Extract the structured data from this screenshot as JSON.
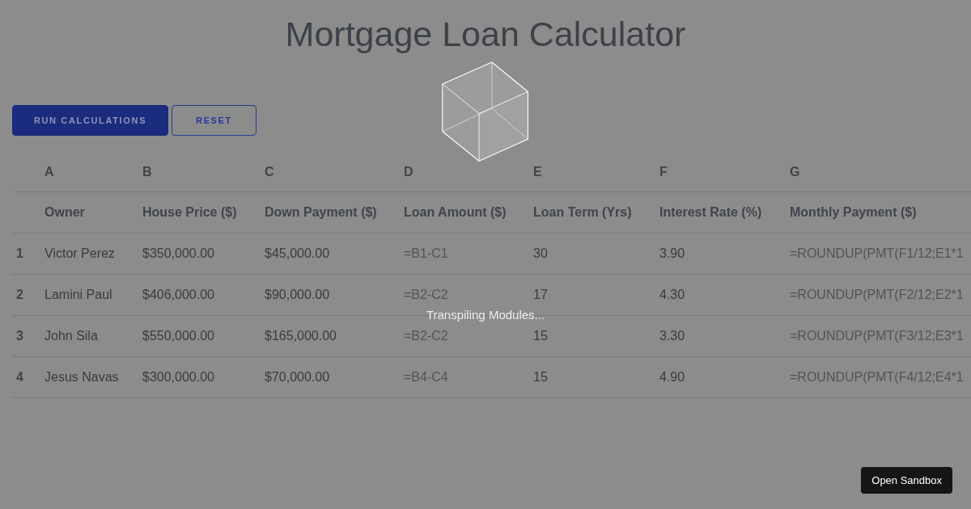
{
  "title": "Mortgage Loan Calculator",
  "buttons": [
    {
      "kind": "primary",
      "label": "RUN CALCULATIONS"
    },
    {
      "kind": "outline",
      "label": "RESET"
    }
  ],
  "table": {
    "columns": [
      {
        "letter": "A",
        "header": "Owner"
      },
      {
        "letter": "B",
        "header": "House Price ($)"
      },
      {
        "letter": "C",
        "header": "Down Payment ($)"
      },
      {
        "letter": "D",
        "header": "Loan Amount ($)"
      },
      {
        "letter": "E",
        "header": "Loan Term (Yrs)"
      },
      {
        "letter": "F",
        "header": "Interest Rate (%)"
      },
      {
        "letter": "G",
        "header": "Monthly Payment ($)"
      }
    ],
    "rows": [
      {
        "number": "1",
        "cells": [
          {
            "kind": "value",
            "text": "Victor Perez"
          },
          {
            "kind": "value",
            "text": "$350,000.00"
          },
          {
            "kind": "value",
            "text": "$45,000.00"
          },
          {
            "kind": "formula",
            "text": "=B1-C1"
          },
          {
            "kind": "value",
            "text": "30"
          },
          {
            "kind": "value",
            "text": "3.90"
          },
          {
            "kind": "formula",
            "text": "=ROUNDUP(PMT(F1/12;E1*1"
          }
        ]
      },
      {
        "number": "2",
        "cells": [
          {
            "kind": "value",
            "text": "Lamini Paul"
          },
          {
            "kind": "value",
            "text": "$406,000.00"
          },
          {
            "kind": "value",
            "text": "$90,000.00"
          },
          {
            "kind": "formula",
            "text": "=B2-C2"
          },
          {
            "kind": "value",
            "text": "17"
          },
          {
            "kind": "value",
            "text": "4.30"
          },
          {
            "kind": "formula",
            "text": "=ROUNDUP(PMT(F2/12;E2*1"
          }
        ]
      },
      {
        "number": "3",
        "cells": [
          {
            "kind": "value",
            "text": "John Sila"
          },
          {
            "kind": "value",
            "text": "$550,000.00"
          },
          {
            "kind": "value",
            "text": "$165,000.00"
          },
          {
            "kind": "formula",
            "text": "=B2-C2"
          },
          {
            "kind": "value",
            "text": "15"
          },
          {
            "kind": "value",
            "text": "3.30"
          },
          {
            "kind": "formula",
            "text": "=ROUNDUP(PMT(F3/12;E3*1"
          }
        ]
      },
      {
        "number": "4",
        "cells": [
          {
            "kind": "value",
            "text": "Jesus Navas"
          },
          {
            "kind": "value",
            "text": "$300,000.00"
          },
          {
            "kind": "value",
            "text": "$70,000.00"
          },
          {
            "kind": "formula",
            "text": "=B4-C4"
          },
          {
            "kind": "value",
            "text": "15"
          },
          {
            "kind": "value",
            "text": "4.90"
          },
          {
            "kind": "formula",
            "text": "=ROUNDUP(PMT(F4/12;E4*1"
          }
        ]
      }
    ]
  },
  "loading": {
    "message": "Transpiling Modules..."
  },
  "sandbox_button": {
    "label": "Open Sandbox"
  }
}
